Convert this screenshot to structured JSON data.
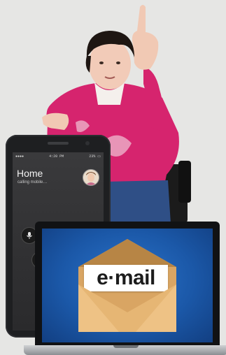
{
  "phone": {
    "status_left": "●●●● ",
    "status_time": "4:20 PM",
    "status_right": "23% ▭",
    "call_name": "Home",
    "call_status": "calling mobile…",
    "buttons": [
      {
        "icon": "mute-icon"
      },
      {
        "icon": "keypad-icon"
      },
      {
        "icon": "speaker-icon"
      },
      {
        "icon": "add-call-icon"
      }
    ]
  },
  "laptop": {
    "email_label": "e·mail"
  },
  "colors": {
    "background": "#e6e6e4",
    "hoodie": "#d6246e",
    "screen_blue": "#1b58a8",
    "envelope": "#e2b06f"
  }
}
